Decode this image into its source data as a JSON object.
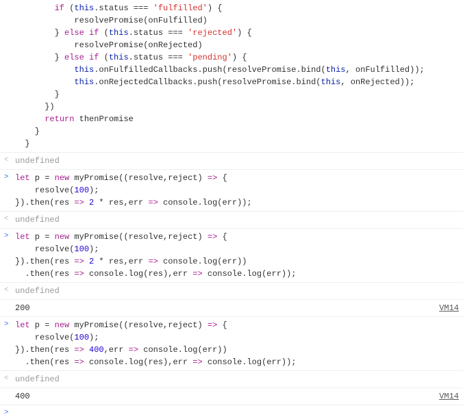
{
  "entries": [
    {
      "type": "code",
      "html": "        <span class='kw'>if</span> (<span class='th'>this</span>.status === <span class='str'>'fulfilled'</span>) {\n            resolvePromise(onFulfilled)\n        } <span class='kw'>else if</span> (<span class='th'>this</span>.status === <span class='str'>'rejected'</span>) {\n            resolvePromise(onRejected)\n        } <span class='kw'>else if</span> (<span class='th'>this</span>.status === <span class='str'>'pending'</span>) {\n            <span class='th'>this</span>.onFulfilledCallbacks.push(resolvePromise.bind(<span class='th'>this</span>, onFulfilled));\n            <span class='th'>this</span>.onRejectedCallbacks.push(resolvePromise.bind(<span class='th'>this</span>, onRejected));\n        }\n      })\n      <span class='kw'>return</span> thenPromise\n    }\n  }"
    },
    {
      "type": "result",
      "text": "undefined"
    },
    {
      "type": "input",
      "html": "<span class='kw'>let</span> p = <span class='kw'>new</span> myPromise((resolve,reject) <span class='arrow'>=></span> {\n    resolve(<span class='num'>100</span>);\n}).then(res <span class='arrow'>=></span> <span class='num'>2</span> * res,err <span class='arrow'>=></span> console.log(err));"
    },
    {
      "type": "result",
      "text": "undefined"
    },
    {
      "type": "input",
      "html": "<span class='kw'>let</span> p = <span class='kw'>new</span> myPromise((resolve,reject) <span class='arrow'>=></span> {\n    resolve(<span class='num'>100</span>);\n}).then(res <span class='arrow'>=></span> <span class='num'>2</span> * res,err <span class='arrow'>=></span> console.log(err))\n  .then(res <span class='arrow'>=></span> console.log(res),err <span class='arrow'>=></span> console.log(err));"
    },
    {
      "type": "result",
      "text": "undefined"
    },
    {
      "type": "log",
      "text": "200",
      "link": "VM14"
    },
    {
      "type": "input",
      "html": "<span class='kw'>let</span> p = <span class='kw'>new</span> myPromise((resolve,reject) <span class='arrow'>=></span> {\n    resolve(<span class='num'>100</span>);\n}).then(res <span class='arrow'>=></span> <span class='num'>400</span>,err <span class='arrow'>=></span> console.log(err))\n  .then(res <span class='arrow'>=></span> console.log(res),err <span class='arrow'>=></span> console.log(err));"
    },
    {
      "type": "result",
      "text": "undefined"
    },
    {
      "type": "log",
      "text": "400",
      "link": "VM14"
    },
    {
      "type": "prompt"
    }
  ]
}
